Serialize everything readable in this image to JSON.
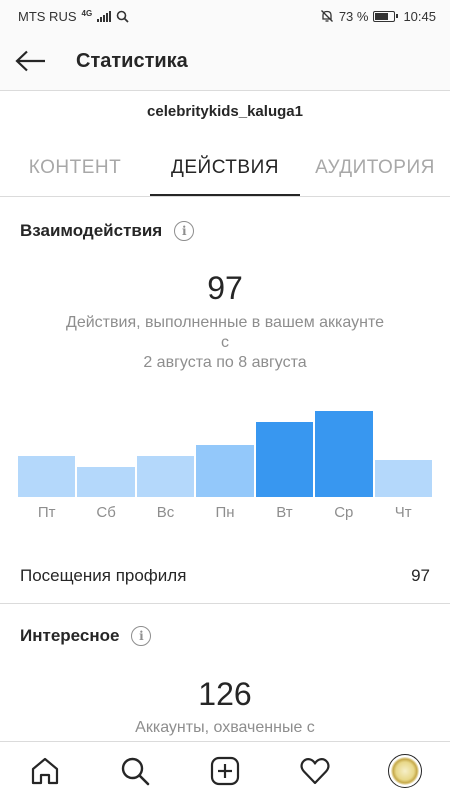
{
  "status_bar": {
    "carrier": "MTS RUS",
    "network": "4G",
    "battery_text": "73 %",
    "battery_level": 0.73,
    "time": "10:45"
  },
  "header": {
    "title": "Статистика",
    "back_icon": "arrow-left-icon"
  },
  "account": {
    "username": "celebritykids_kaluga1"
  },
  "tabs": [
    {
      "label": "КОНТЕНТ",
      "active": false
    },
    {
      "label": "ДЕЙСТВИЯ",
      "active": true
    },
    {
      "label": "АУДИТОРИЯ",
      "active": false
    }
  ],
  "interactions": {
    "title": "Взаимодействия",
    "total": "97",
    "caption_line1": "Действия, выполненные в вашем аккаунте с",
    "caption_line2": "2 августа по 8 августа"
  },
  "chart_data": {
    "type": "bar",
    "categories": [
      "Пт",
      "Сб",
      "Вс",
      "Пн",
      "Вт",
      "Ср",
      "Чт"
    ],
    "values": [
      11,
      8,
      11,
      14,
      20,
      23,
      10
    ],
    "ylim": [
      0,
      26
    ],
    "grid": false,
    "colors": [
      "#b4d8fb",
      "#b4d8fb",
      "#b4d8fb",
      "#93c8fa",
      "#3897f0",
      "#3897f0",
      "#b4d8fb"
    ]
  },
  "profile_visits": {
    "label": "Посещения профиля",
    "value": "97"
  },
  "discovery": {
    "title": "Интересное",
    "total": "126",
    "caption": "Аккаунты, охваченные с"
  },
  "bottom_nav": [
    "home-icon",
    "search-icon",
    "add-post-icon",
    "heart-icon",
    "profile-avatar"
  ]
}
